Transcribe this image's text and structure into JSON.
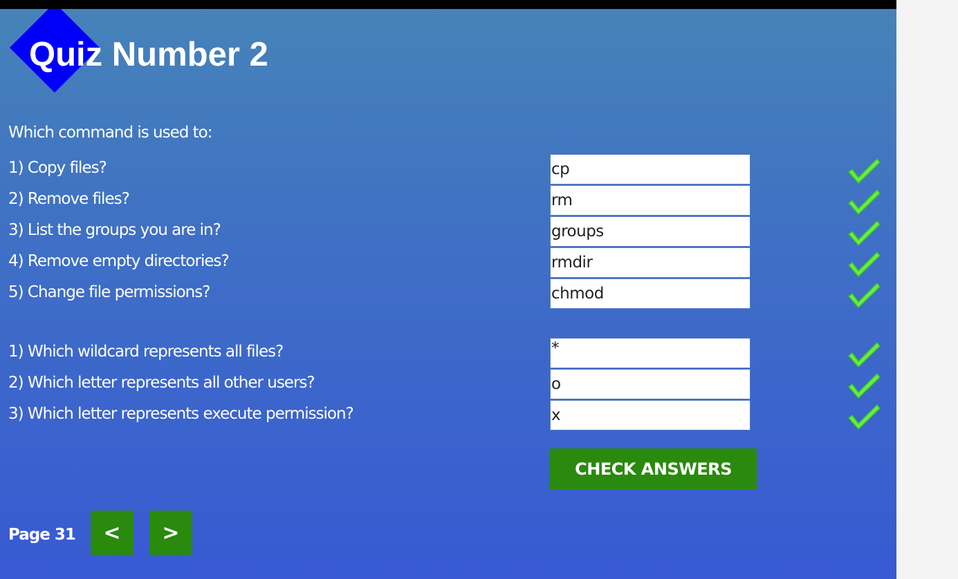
{
  "quiz": {
    "title": "Quiz Number 2",
    "prompt": "Which command is used to:",
    "group1": [
      {
        "label": "1) Copy files?",
        "answer": "cp",
        "status": "correct"
      },
      {
        "label": "2) Remove files?",
        "answer": "rm",
        "status": "correct"
      },
      {
        "label": "3) List the groups you are in?",
        "answer": "groups",
        "status": "correct"
      },
      {
        "label": "4) Remove empty directories?",
        "answer": "rmdir",
        "status": "correct"
      },
      {
        "label": "5) Change file permissions?",
        "answer": "chmod",
        "status": "correct"
      }
    ],
    "group2": [
      {
        "label": "1) Which wildcard represents all files?",
        "answer": "*",
        "status": "correct"
      },
      {
        "label": "2) Which letter represents all other users?",
        "answer": "o",
        "status": "correct"
      },
      {
        "label": "3) Which letter represents execute permission?",
        "answer": "x",
        "status": "correct"
      }
    ],
    "check_button": "CHECK ANSWERS",
    "check_icon": "checkmark-icon",
    "check_color": "#66ee44"
  },
  "nav": {
    "page_label": "Page 31",
    "prev": "<",
    "next": ">"
  },
  "colors": {
    "diamond": "#0000fa",
    "button": "#2a8a0d",
    "gradient_top": "#4683b8",
    "gradient_bottom": "#3859d3"
  }
}
